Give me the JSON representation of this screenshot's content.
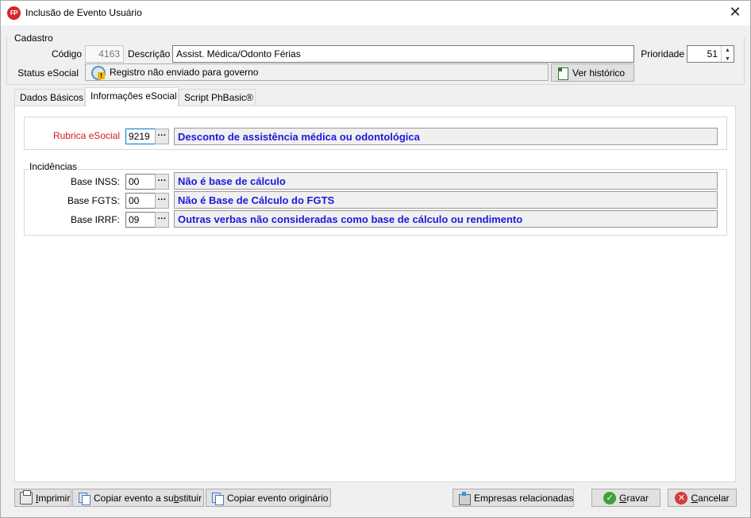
{
  "window": {
    "app_icon_text": "FP",
    "title": "Inclusão de Evento Usuário",
    "close_glyph": "✕"
  },
  "cadastro": {
    "group_label": "Cadastro",
    "codigo_label": "Código",
    "codigo_value": "4163",
    "descricao_label": "Descrição",
    "descricao_value": "Assist. Médica/Odonto Férias",
    "prioridade_label": "Prioridade",
    "prioridade_value": "51",
    "status_label": "Status eSocial",
    "status_value": "Registro não enviado para governo",
    "ver_historico_label": "Ver histórico"
  },
  "tabs": [
    {
      "label": "Dados Básicos",
      "active": false
    },
    {
      "label": "Informações eSocial",
      "active": true
    },
    {
      "label": "Script PhBasic®",
      "active": false
    }
  ],
  "esocial": {
    "rubrica_label": "Rubrica eSocial",
    "rubrica_label_color": "#d11a1a",
    "rubrica_code": "9219",
    "rubrica_desc": "Desconto de assistência médica ou odontológica",
    "ellipsis": "···",
    "incidencias_label": "Incidências",
    "rows": [
      {
        "label": "Base INSS:",
        "code": "00",
        "desc": "Não é base de cálculo"
      },
      {
        "label": "Base FGTS:",
        "code": "00",
        "desc": "Não é Base de Cálculo do FGTS"
      },
      {
        "label": "Base IRRF:",
        "code": "09",
        "desc": "Outras verbas não consideradas como base de cálculo ou rendimento"
      }
    ]
  },
  "footer": {
    "imprimir_pre": "",
    "imprimir_u": "I",
    "imprimir_post": "mprimir",
    "copiar_substituir_pre": "Copiar evento a su",
    "copiar_substituir_u": "b",
    "copiar_substituir_post": "stituir",
    "copiar_originario": "Copiar evento originário",
    "empresas": "Empresas relacionadas",
    "gravar_u": "G",
    "gravar_post": "ravar",
    "cancelar_u": "C",
    "cancelar_post": "ancelar"
  },
  "colors": {
    "desc_text": "#1a1adb",
    "focus_border": "#0078d7"
  }
}
